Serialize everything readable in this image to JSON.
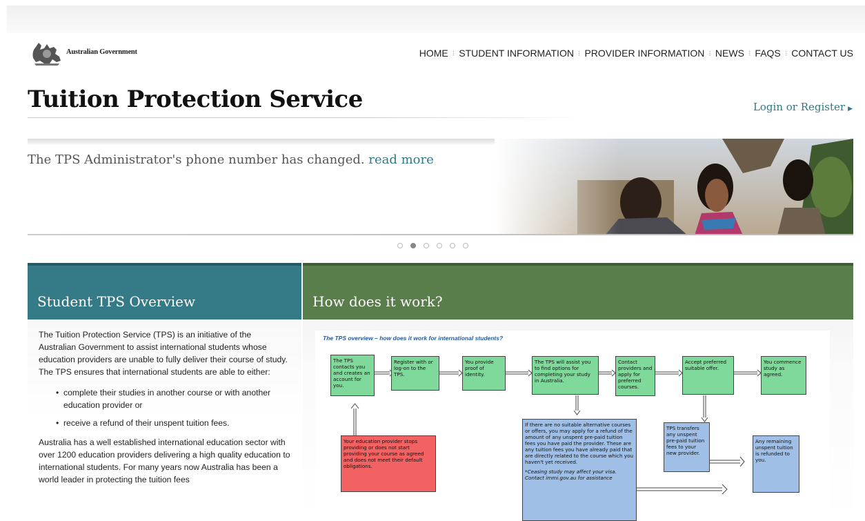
{
  "header": {
    "logo_text": "Australian Government",
    "nav": [
      "HOME",
      "STUDENT INFORMATION",
      "PROVIDER INFORMATION",
      "NEWS",
      "FAQS",
      "CONTACT US"
    ],
    "site_title": "Tuition Protection Service",
    "login_label": "Login or Register"
  },
  "banner": {
    "message": "The TPS Administrator's phone number has changed.",
    "link": "read more",
    "slides": 6,
    "active_slide": 2
  },
  "left_panel": {
    "heading": "Student TPS Overview",
    "intro": "The Tuition Protection Service (TPS) is an initiative of the Australian Government to assist international students whose education providers are unable to fully deliver their course of study. The TPS ensures that international students are able to either:",
    "bullets": [
      "complete their studies in another course or with another education provider or",
      "receive a refund of their unspent tuition fees."
    ],
    "para2": "Australia has a well established international education sector with over 1200 education providers delivering a high quality education to international students. For many years now Australia has been a world leader in protecting the tuition fees"
  },
  "right_panel": {
    "heading": "How does it work?",
    "diagram": {
      "title": "The TPS overview – how does it work for international students?",
      "boxes": {
        "b1": "The TPS contacts you and creates an account for you.",
        "b2": "Register with or log-on to the TPS.",
        "b3": "You provide proof of identity.",
        "b4": "The TPS will assist you to find options for completing your study in Australia.",
        "b5": "Contact providers and apply for preferred courses.",
        "b6": "Accept preferred suitable offer.",
        "b7": "You commence study as agreed.",
        "red": "Your education provider stops providing or does not start providing your course as agreed and does not meet their default obligations.",
        "blue_main": "If there are no suitable alternative courses or offers, you may apply for a refund of the amount of any unspent pre-paid tuition fees you have paid the provider. These are any tuition fees you have already paid that are directly related to the course which you haven't yet received.",
        "blue_note": "*Ceasing study may affect your visa. Contact immi.gov.au for assistance",
        "blue_transfer": "TPS transfers any unspent pre-paid tuition fees to your new provider.",
        "blue_refund": "Any remaining unspent tuition is refunded to you."
      }
    }
  }
}
